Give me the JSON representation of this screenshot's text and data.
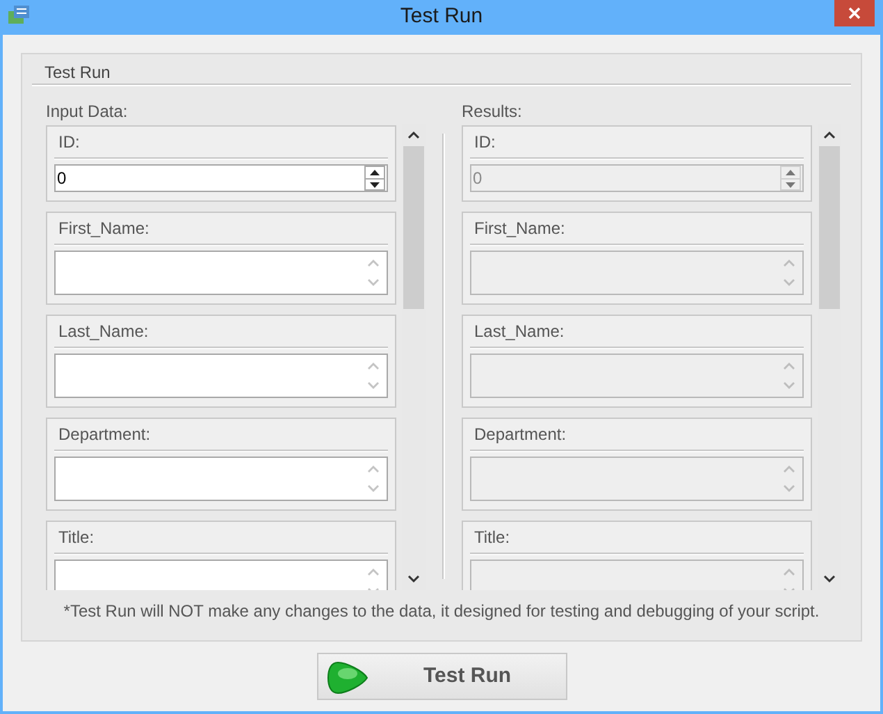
{
  "window": {
    "title": "Test Run"
  },
  "group": {
    "title": "Test Run"
  },
  "panels": [
    {
      "label": "Input Data:",
      "fields": [
        {
          "label": "ID:",
          "kind": "spin",
          "value": "0",
          "disabled": false
        },
        {
          "label": "First_Name:",
          "kind": "text",
          "disabled": false
        },
        {
          "label": "Last_Name:",
          "kind": "text",
          "disabled": false
        },
        {
          "label": "Department:",
          "kind": "text",
          "disabled": false
        },
        {
          "label": "Title:",
          "kind": "text",
          "disabled": false
        }
      ]
    },
    {
      "label": "Results:",
      "fields": [
        {
          "label": "ID:",
          "kind": "spin",
          "value": "0",
          "disabled": true
        },
        {
          "label": "First_Name:",
          "kind": "text",
          "disabled": true
        },
        {
          "label": "Last_Name:",
          "kind": "text",
          "disabled": true
        },
        {
          "label": "Department:",
          "kind": "text",
          "disabled": true
        },
        {
          "label": "Title:",
          "kind": "text",
          "disabled": true
        }
      ]
    }
  ],
  "note": "*Test Run will NOT make any changes to the data, it designed for testing and debugging of your script.",
  "run_button": {
    "label": "Test Run"
  }
}
